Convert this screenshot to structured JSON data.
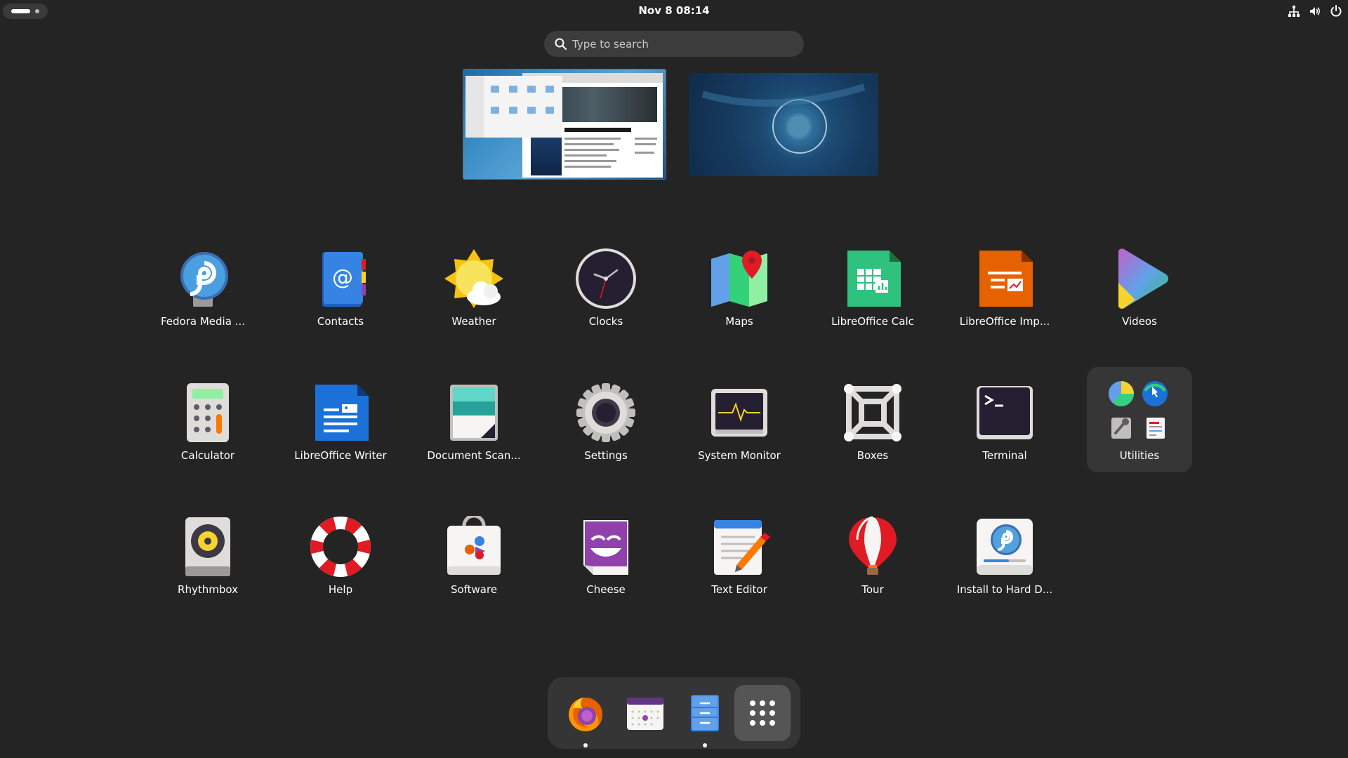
{
  "topbar": {
    "clock": "Nov 8  08:14",
    "tray_icons": [
      "network-icon",
      "volume-icon",
      "power-icon"
    ]
  },
  "search": {
    "placeholder": "Type to search"
  },
  "workspaces": [
    {
      "name": "workspace-1",
      "windows": [
        "files",
        "web-browser"
      ]
    },
    {
      "name": "workspace-2",
      "windows": []
    }
  ],
  "apps": [
    {
      "label": "Fedora Media ...",
      "icon": "fedora-media-writer-icon"
    },
    {
      "label": "Contacts",
      "icon": "contacts-icon"
    },
    {
      "label": "Weather",
      "icon": "weather-icon"
    },
    {
      "label": "Clocks",
      "icon": "clocks-icon"
    },
    {
      "label": "Maps",
      "icon": "maps-icon"
    },
    {
      "label": "LibreOffice Calc",
      "icon": "libreoffice-calc-icon"
    },
    {
      "label": "LibreOffice Imp...",
      "icon": "libreoffice-impress-icon"
    },
    {
      "label": "Videos",
      "icon": "videos-icon"
    },
    {
      "label": "Calculator",
      "icon": "calculator-icon"
    },
    {
      "label": "LibreOffice Writer",
      "icon": "libreoffice-writer-icon"
    },
    {
      "label": "Document Scan...",
      "icon": "document-scanner-icon"
    },
    {
      "label": "Settings",
      "icon": "settings-icon"
    },
    {
      "label": "System Monitor",
      "icon": "system-monitor-icon"
    },
    {
      "label": "Boxes",
      "icon": "boxes-icon"
    },
    {
      "label": "Terminal",
      "icon": "terminal-icon"
    },
    {
      "label": "Utilities",
      "icon": "utilities-folder-icon"
    },
    {
      "label": "Rhythmbox",
      "icon": "rhythmbox-icon"
    },
    {
      "label": "Help",
      "icon": "help-icon"
    },
    {
      "label": "Software",
      "icon": "software-icon"
    },
    {
      "label": "Cheese",
      "icon": "cheese-icon"
    },
    {
      "label": "Text Editor",
      "icon": "text-editor-icon"
    },
    {
      "label": "Tour",
      "icon": "tour-icon"
    },
    {
      "label": "Install to Hard D...",
      "icon": "install-to-hard-drive-icon"
    }
  ],
  "dash": [
    {
      "app": "firefox",
      "icon": "firefox-icon",
      "running": true
    },
    {
      "app": "calendar",
      "icon": "calendar-icon",
      "running": false
    },
    {
      "app": "files",
      "icon": "files-icon",
      "running": true
    },
    {
      "app": "show-apps",
      "icon": "app-grid-icon",
      "running": false
    }
  ]
}
